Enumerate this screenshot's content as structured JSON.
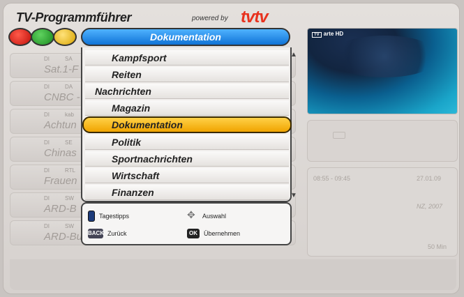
{
  "header": {
    "app_title": "TV-Programmführer",
    "powered_by": "powered by",
    "logo": "tvtv",
    "category_title": "Dokumentation"
  },
  "color_buttons": [
    "red",
    "green",
    "yellow"
  ],
  "background_rows": [
    {
      "day": "DI",
      "ch": "SA",
      "title": "Sat.1-F"
    },
    {
      "day": "DI",
      "ch": "DA",
      "title": "CNBC -"
    },
    {
      "day": "DI",
      "ch": "kab",
      "title": "Achtun"
    },
    {
      "day": "DI",
      "ch": "SE",
      "title": "Chinas"
    },
    {
      "day": "DI",
      "ch": "RTL",
      "title": "Frauen"
    },
    {
      "day": "DI",
      "ch": "SW",
      "title": "ARD-B"
    },
    {
      "day": "DI",
      "ch": "SW",
      "title": "ARD-Buffet"
    }
  ],
  "dropdown": {
    "items": [
      {
        "label": "Kampfsport",
        "level": "indent"
      },
      {
        "label": "Reiten",
        "level": "indent"
      },
      {
        "label": "Nachrichten",
        "level": "top"
      },
      {
        "label": "Magazin",
        "level": "indent"
      },
      {
        "label": "Dokumentation",
        "level": "selected"
      },
      {
        "label": "Politik",
        "level": "indent"
      },
      {
        "label": "Sportnachrichten",
        "level": "indent"
      },
      {
        "label": "Wirtschaft",
        "level": "indent"
      },
      {
        "label": "Finanzen",
        "level": "indent"
      }
    ]
  },
  "legend": {
    "tagestipps": "Tagestipps",
    "auswahl": "Auswahl",
    "back_key": "BACK",
    "zurueck": "Zurück",
    "ok_key": "OK",
    "uebernehmen": "Übernehmen"
  },
  "preview": {
    "tv_label": "TV",
    "channel": "arte HD"
  },
  "info": {
    "time": "08:55 - 09:45",
    "date": "27.01.09",
    "country_year": "NZ, 2007",
    "duration": "50 Min"
  },
  "colors": {
    "accent_blue": "#1073d6",
    "selected_orange": "#f0a400",
    "logo_red": "#e8321e"
  }
}
